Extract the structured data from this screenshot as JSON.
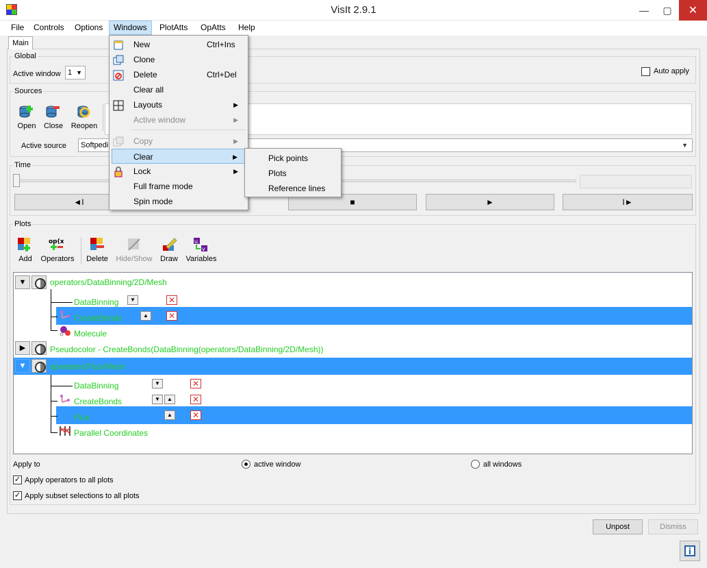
{
  "window": {
    "title": "VisIt 2.9.1",
    "minimize": "—",
    "maximize": "▢",
    "close": "✕"
  },
  "menubar": [
    "File",
    "Controls",
    "Options",
    "Windows",
    "PlotAtts",
    "OpAtts",
    "Help"
  ],
  "tab": "Main",
  "global": {
    "title": "Global",
    "active_window_label": "Active window",
    "active_window_value": "1",
    "auto_apply_label": "Auto apply"
  },
  "sources": {
    "title": "Sources",
    "open": "Open",
    "close": "Close",
    "reopen": "Reopen",
    "active_source_label": "Active source",
    "active_source_value": "Softpedi"
  },
  "time": {
    "title": "Time",
    "controls": [
      "◄I",
      "■",
      "►",
      "I►"
    ]
  },
  "plots": {
    "title": "Plots",
    "toolbar": [
      "Add",
      "Operators",
      "Delete",
      "Hide/Show",
      "Draw",
      "Variables"
    ],
    "entries": [
      {
        "label": "operators/DataBinning/2D/Mesh",
        "children": [
          "DataBinning",
          "CreateBonds",
          "Molecule"
        ]
      },
      {
        "label": "Pseudocolor - CreateBonds(DataBinning(operators/DataBinning/2D/Mesh))"
      },
      {
        "label": "operators/Flux/Mesh",
        "children": [
          "DataBinning",
          "CreateBonds",
          "Flux",
          "Parallel Coordinates"
        ]
      }
    ],
    "apply_to_label": "Apply to",
    "apply_active": "active window",
    "apply_all": "all windows",
    "apply_operators": "Apply operators to all plots",
    "apply_subset": "Apply subset selections to all plots"
  },
  "bottom": {
    "unpost": "Unpost",
    "dismiss": "Dismiss"
  },
  "windows_menu": {
    "items": [
      {
        "label": "New",
        "shortcut": "Ctrl+Ins"
      },
      {
        "label": "Clone"
      },
      {
        "label": "Delete",
        "shortcut": "Ctrl+Del"
      },
      {
        "label": "Clear all"
      },
      {
        "label": "Layouts"
      },
      {
        "label": "Active window"
      },
      {
        "label": "Copy"
      },
      {
        "label": "Clear"
      },
      {
        "label": "Lock"
      },
      {
        "label": "Full frame mode"
      },
      {
        "label": "Spin mode"
      }
    ]
  },
  "clear_submenu": [
    "Pick points",
    "Plots",
    "Reference lines"
  ],
  "colors": {
    "selection": "#3399ff",
    "plot_text": "#22cc22",
    "menu_highlight": "#cce4f7"
  }
}
